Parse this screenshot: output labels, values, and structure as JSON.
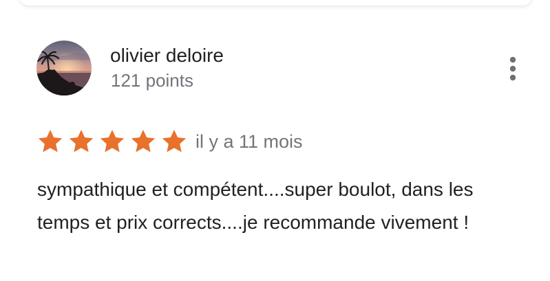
{
  "review": {
    "author_name": "olivier deloire",
    "author_points": "121 points",
    "rating": 5,
    "rating_max": 5,
    "date": "il y a 11 mois",
    "text": "sympathique et compétent....super boulot, dans les temps et prix corrects....je recommande vivement !"
  },
  "icons": {
    "more": "more-vert-icon",
    "star": "star-icon",
    "avatar": "sunset-photo"
  },
  "colors": {
    "star": "#E8712C",
    "name": "#202124",
    "secondary": "#70757A"
  }
}
